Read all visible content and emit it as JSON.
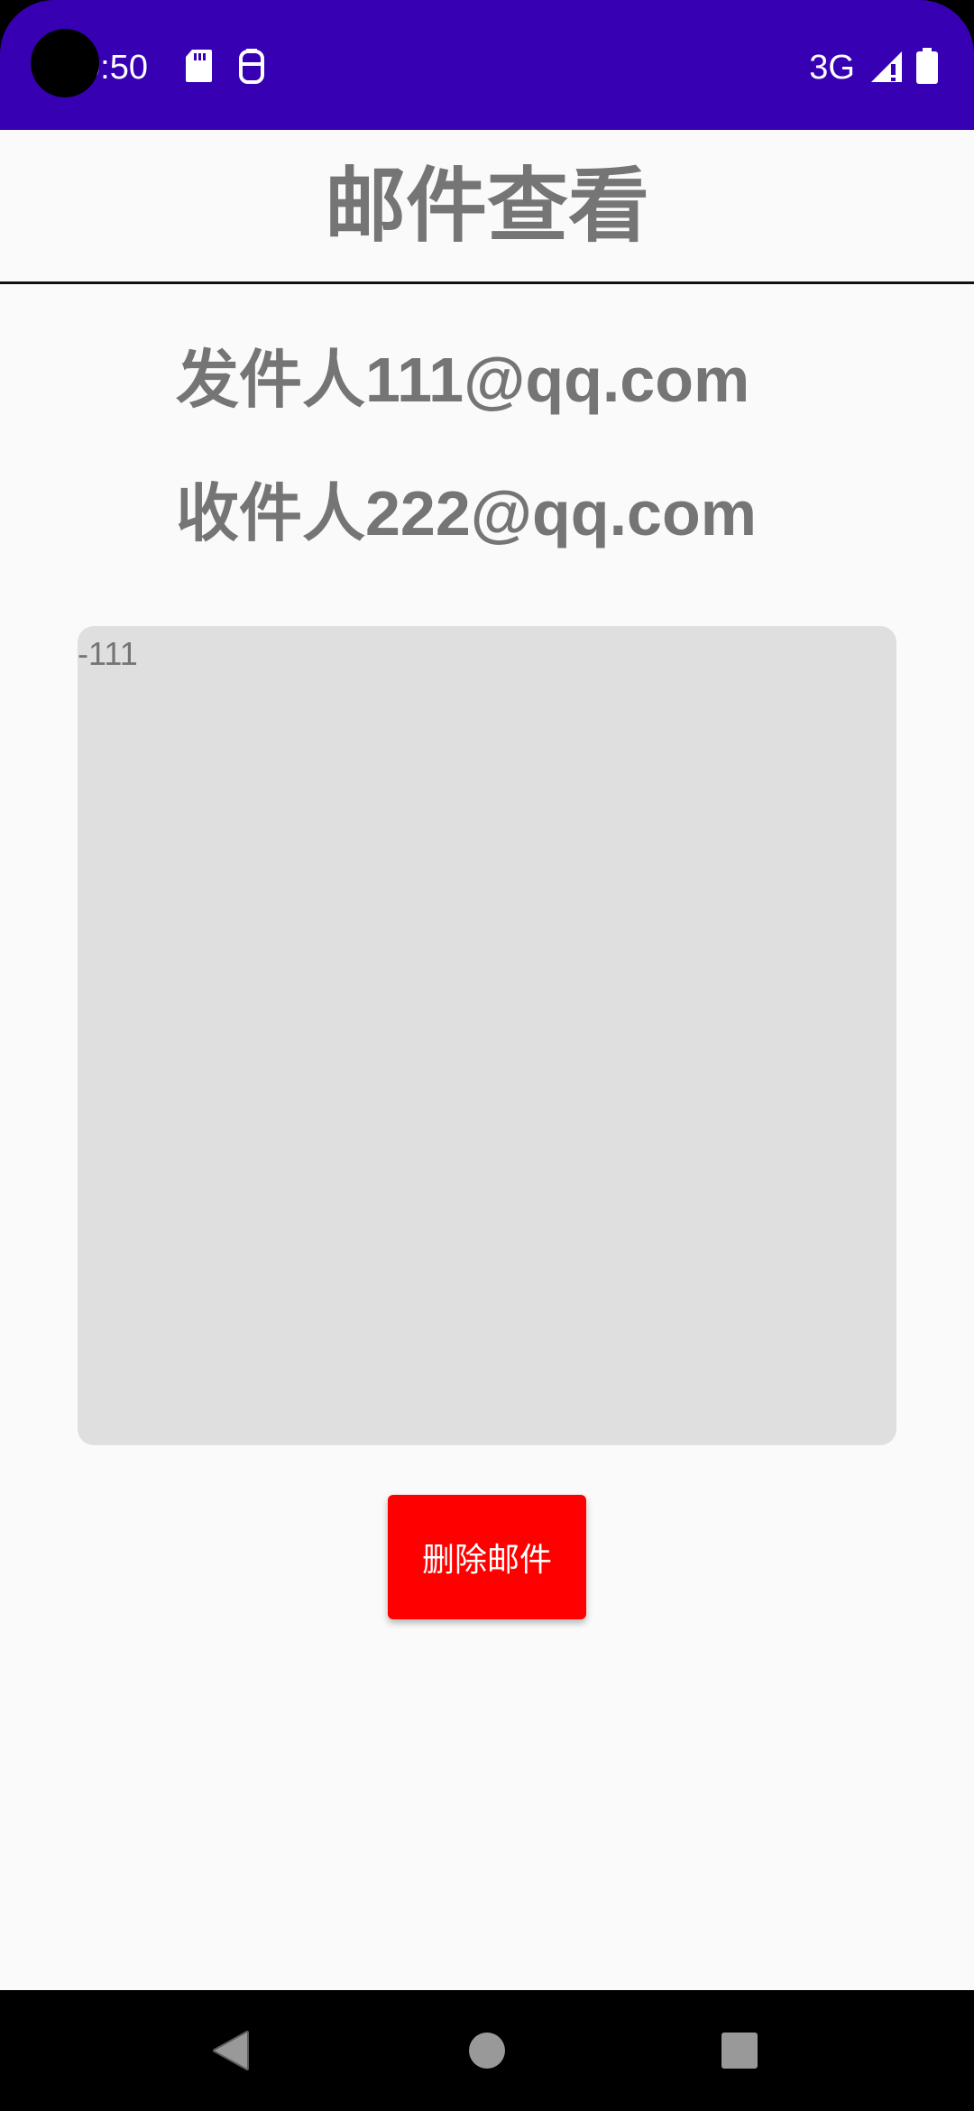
{
  "status_bar": {
    "time": "0:50",
    "network": "3G",
    "icons": [
      "sd-card-icon",
      "notification-icon",
      "signal-icon",
      "battery-icon"
    ],
    "background_color": "#3700b3"
  },
  "app": {
    "title": "邮件查看",
    "sender_line": "发件人111@qq.com",
    "receiver_line": "收件人222@qq.com",
    "body_text": "-111",
    "delete_button_label": "删除邮件",
    "delete_button_color": "#ff0000"
  },
  "nav_bar": {
    "buttons": [
      "back-icon",
      "home-icon",
      "recents-icon"
    ]
  }
}
